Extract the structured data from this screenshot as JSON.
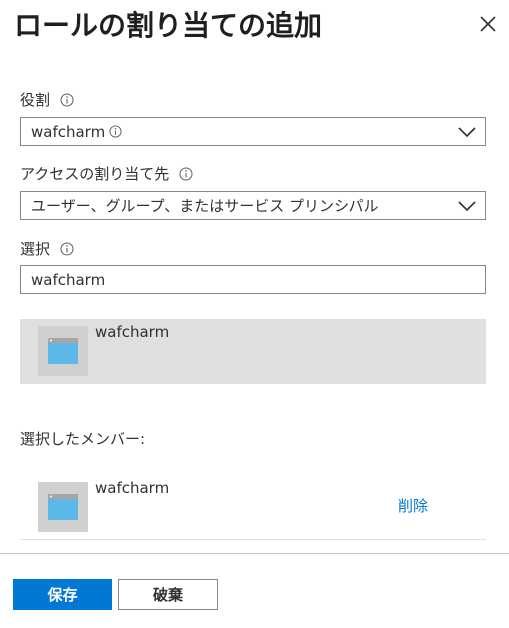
{
  "header": {
    "title": "ロールの割り当ての追加",
    "close_icon": "close-icon"
  },
  "role": {
    "label": "役割",
    "value": "wafcharm"
  },
  "assign_access": {
    "label": "アクセスの割り当て先",
    "value": "ユーザー、グループ、またはサービス プリンシパル"
  },
  "select": {
    "label": "選択",
    "value": "wafcharm"
  },
  "results": [
    {
      "name": "wafcharm",
      "icon": "app-registration-icon"
    }
  ],
  "selected_members": {
    "label": "選択したメンバー:",
    "items": [
      {
        "name": "wafcharm",
        "icon": "app-registration-icon",
        "remove_label": "削除"
      }
    ]
  },
  "footer": {
    "save_label": "保存",
    "discard_label": "破棄"
  },
  "colors": {
    "accent": "#0078d4",
    "selected_bg": "#e1dfdd",
    "icon_blue": "#5bb8e8"
  }
}
